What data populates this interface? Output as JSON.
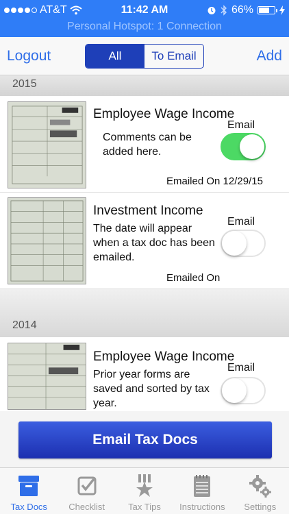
{
  "status": {
    "carrier": "AT&T",
    "time": "11:42 AM",
    "battery": "66%",
    "battery_level": 0.66,
    "signal_bars": 4,
    "hotspot": "Personal Hotspot: 1 Connection"
  },
  "nav": {
    "left": "Logout",
    "right": "Add",
    "segments": [
      "All",
      "To Email"
    ],
    "selected": "All"
  },
  "sections": [
    {
      "year": "2015",
      "items": [
        {
          "title": "Employee Wage Income",
          "comment": "Comments can be added here.",
          "email_label": "Email",
          "email_on": true,
          "emailed": "Emailed On 12/29/15"
        },
        {
          "title": "Investment Income",
          "comment": "The date will appear when a tax doc has been emailed.",
          "email_label": "Email",
          "email_on": false,
          "emailed": "Emailed On"
        }
      ]
    },
    {
      "year": "2014",
      "items": [
        {
          "title": "Employee Wage Income",
          "comment": "Prior year forms are saved and sorted by tax year.",
          "email_label": "Email",
          "email_on": false,
          "emailed": ""
        }
      ]
    }
  ],
  "email_button": "Email Tax Docs",
  "tabs": [
    {
      "label": "Tax Docs",
      "icon": "archive-box-icon",
      "active": true
    },
    {
      "label": "Checklist",
      "icon": "checklist-icon",
      "active": false
    },
    {
      "label": "Tax Tips",
      "icon": "star-ribbon-icon",
      "active": false
    },
    {
      "label": "Instructions",
      "icon": "notepad-icon",
      "active": false
    },
    {
      "label": "Settings",
      "icon": "gears-icon",
      "active": false
    }
  ],
  "colors": {
    "status_blue": "#2f7df7",
    "accent_blue": "#2f6ee8",
    "segment_blue": "#1e3fb8",
    "toggle_green": "#4cd964"
  }
}
